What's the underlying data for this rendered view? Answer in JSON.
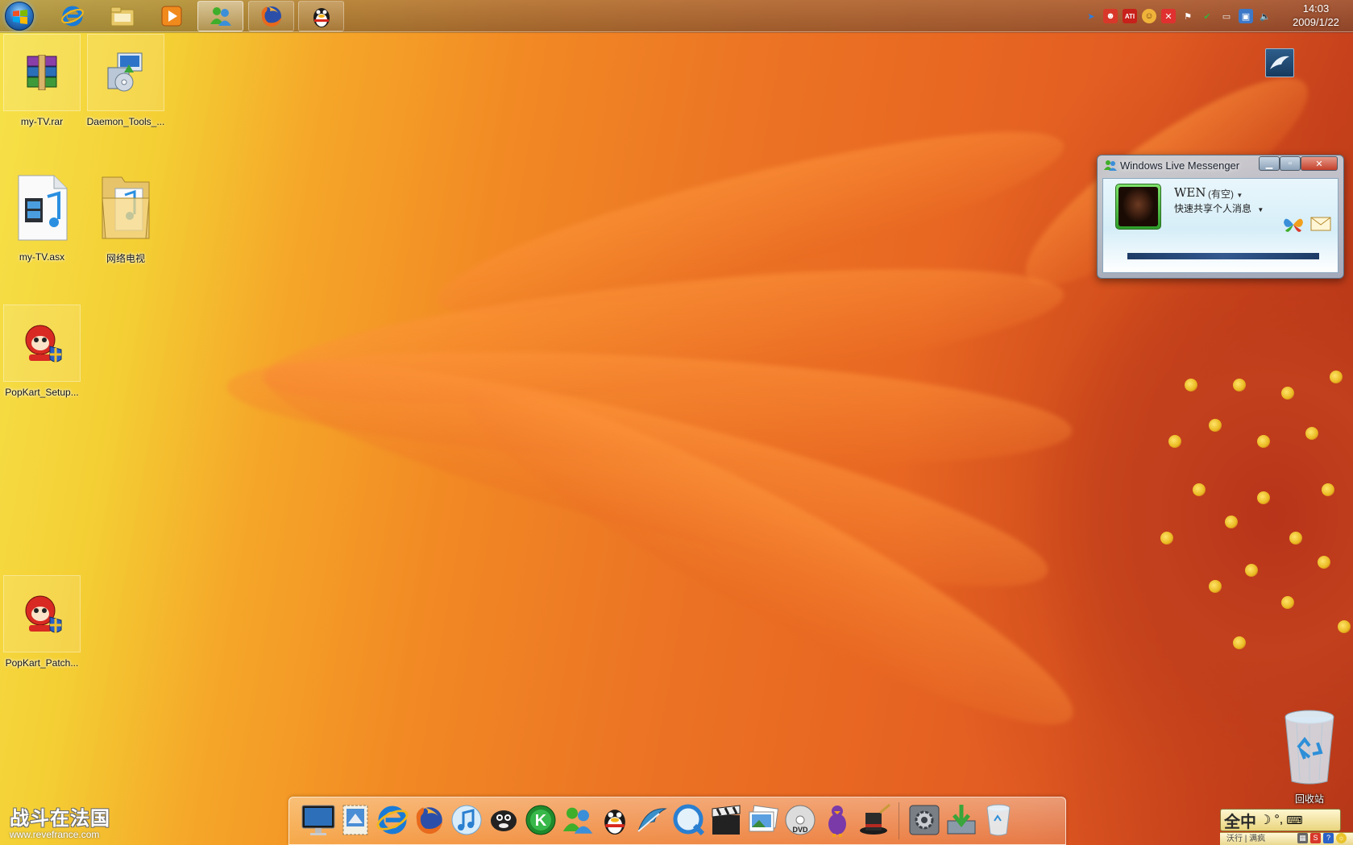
{
  "taskbar": {
    "buttons": [
      {
        "name": "ie-taskbar-button",
        "icon": "internet-explorer-icon"
      },
      {
        "name": "explorer-taskbar-button",
        "icon": "folder-library-icon"
      },
      {
        "name": "media-player-taskbar-button",
        "icon": "media-player-icon"
      },
      {
        "name": "messenger-taskbar-button",
        "icon": "messenger-icon",
        "state": "active"
      },
      {
        "name": "firefox-taskbar-button",
        "icon": "firefox-icon",
        "state": "open"
      },
      {
        "name": "qq-taskbar-button",
        "icon": "qq-penguin-icon",
        "state": "open"
      }
    ],
    "clock": {
      "time": "14:03",
      "date": "2009/1/22"
    },
    "tray_icons": [
      "arrow-icon",
      "people-icon",
      "ati-icon",
      "emoticon-icon",
      "security-icon",
      "flag-icon",
      "shield-icon",
      "network-icon",
      "monitor-icon",
      "volume-icon"
    ],
    "ati_label": "ATI"
  },
  "desktop_icons": [
    {
      "label": "my-TV.rar",
      "icon": "winrar-archive-icon"
    },
    {
      "label": "Daemon_Tools_...",
      "icon": "installer-icon"
    },
    {
      "label": "my-TV.asx",
      "icon": "media-file-icon"
    },
    {
      "label": "网络电视",
      "icon": "folder-icon"
    },
    {
      "label": "PopKart_Setup...",
      "icon": "popkart-icon"
    },
    {
      "label": "PopKart_Patch...",
      "icon": "popkart-icon"
    }
  ],
  "messenger": {
    "title": "Windows Live Messenger",
    "name": "WEN",
    "status": "(有空)",
    "personal_message": "快速共享个人消息"
  },
  "dock": {
    "items": [
      "imac-icon",
      "mail-stamp-icon",
      "internet-explorer-icon",
      "firefox-icon",
      "itunes-icon",
      "sheep-icon",
      "kaspersky-icon",
      "messenger-icon",
      "qq-penguin-icon",
      "feather-icon",
      "quicktime-icon",
      "clapper-icon",
      "photos-icon",
      "dvd-icon",
      "bird-icon",
      "magic-hat-icon",
      "system-preferences-icon",
      "downloads-icon",
      "trash-icon"
    ]
  },
  "recycle_bin": {
    "label": "回收站",
    "icon": "recycle-bin-icon"
  },
  "watermark": {
    "title": "战斗在法国",
    "url": "www.revefrance.com"
  },
  "ime": {
    "mode": "全中",
    "tail": "沃行 | 满疯"
  },
  "colors": {
    "accent": "#f28a24",
    "msn_frame": "#5a7186",
    "taskbar": "#6b4f38"
  }
}
